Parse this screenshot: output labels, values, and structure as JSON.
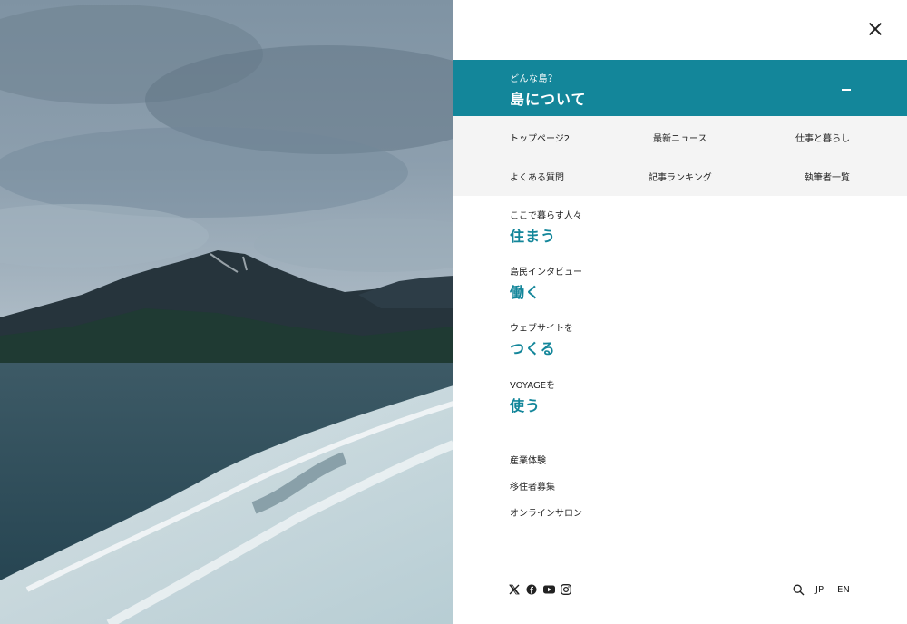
{
  "menu": {
    "featured": {
      "eyebrow": "どんな島？",
      "title": "島について"
    },
    "subnav": [
      "トップページ2",
      "最新ニュース",
      "仕事と暮らし",
      "よくある質問",
      "記事ランキング",
      "執筆者一覧"
    ],
    "categories": [
      {
        "kicker": "ここで暮らす人々",
        "heading": "住まう"
      },
      {
        "kicker": "島民インタビュー",
        "heading": "働く"
      },
      {
        "kicker": "ウェブサイトを",
        "heading": "つくる"
      },
      {
        "kicker": "VOYAGEを",
        "heading": "使う"
      }
    ],
    "links": [
      "産業体験",
      "移住者募集",
      "オンラインサロン"
    ]
  },
  "footer": {
    "social_icons": [
      "x-icon",
      "facebook-icon",
      "youtube-icon",
      "instagram-icon"
    ],
    "search_icon": "search-icon",
    "languages": [
      "JP",
      "EN"
    ]
  },
  "colors": {
    "accent": "#13869a",
    "subnav_bg": "#f4f4f4"
  }
}
